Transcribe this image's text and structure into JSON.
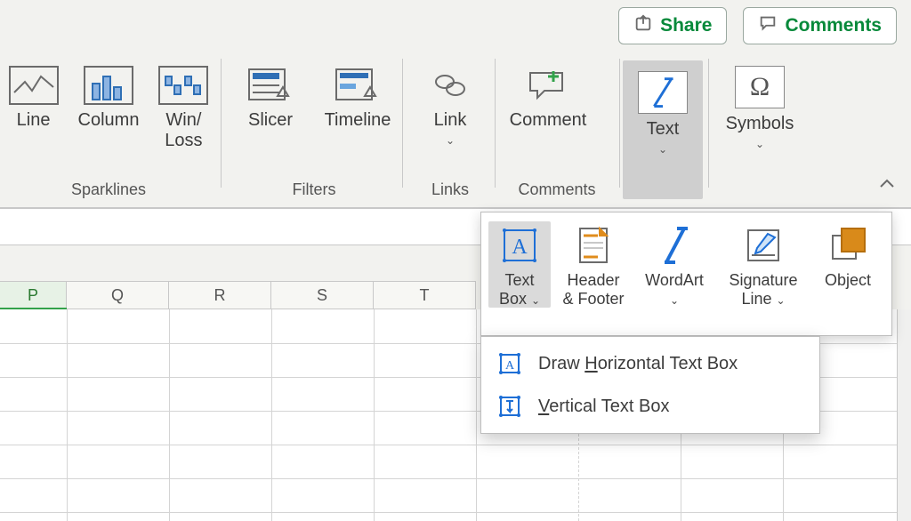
{
  "topButtons": {
    "share": "Share",
    "comments": "Comments"
  },
  "ribbon": {
    "groups": {
      "sparklines": {
        "caption": "Sparklines",
        "line": "Line",
        "column": "Column",
        "winloss_l1": "Win/",
        "winloss_l2": "Loss"
      },
      "filters": {
        "caption": "Filters",
        "slicer": "Slicer",
        "timeline": "Timeline"
      },
      "links": {
        "caption": "Links",
        "link": "Link"
      },
      "comments": {
        "caption": "Comments",
        "comment": "Comment"
      },
      "text": {
        "text": "Text"
      },
      "symbols": {
        "symbols": "Symbols"
      }
    }
  },
  "columns": [
    "P",
    "Q",
    "R",
    "S",
    "T"
  ],
  "gallery": {
    "textbox_l1": "Text",
    "textbox_l2": "Box",
    "header_l1": "Header",
    "header_l2": "& Footer",
    "wordart": "WordArt",
    "sigline_l1": "Signature",
    "sigline_l2": "Line",
    "object": "Object"
  },
  "menu": {
    "horizontal_pre": "Draw ",
    "horizontal_u": "H",
    "horizontal_post": "orizontal Text Box",
    "vertical_u": "V",
    "vertical_post": "ertical Text Box"
  }
}
